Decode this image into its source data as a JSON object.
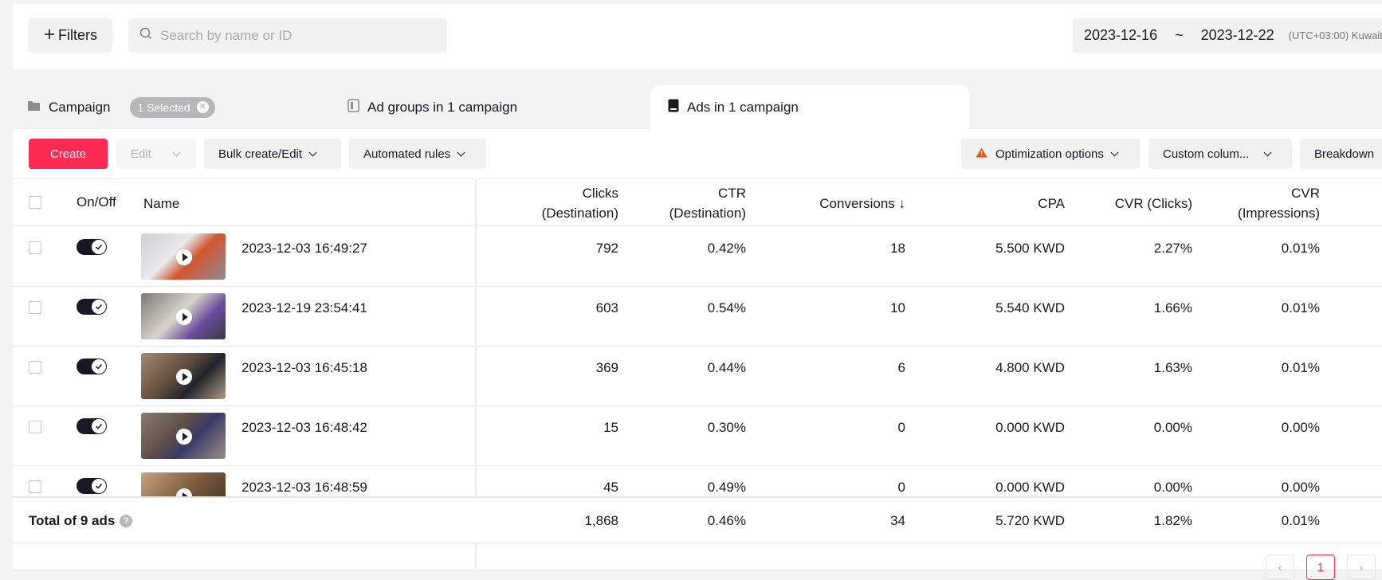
{
  "topbar": {
    "filters_label": "Filters",
    "search_placeholder": "Search by name or ID",
    "date_start": "2023-12-16",
    "date_sep": "~",
    "date_end": "2023-12-22",
    "timezone": "(UTC+03:00) Kuwait"
  },
  "tabs": {
    "campaign_label": "Campaign",
    "selected_pill": "1 Selected",
    "adgroups_label": "Ad groups in 1 campaign",
    "ads_label": "Ads in 1 campaign"
  },
  "toolbar": {
    "create_label": "Create",
    "edit_label": "Edit",
    "bulk_label": "Bulk create/Edit",
    "rules_label": "Automated rules",
    "optimization_label": "Optimization options",
    "custom_columns_label": "Custom colum...",
    "breakdown_label": "Breakdown"
  },
  "table": {
    "headers": {
      "onoff": "On/Off",
      "name": "Name",
      "clicks_l1": "Clicks",
      "clicks_l2": "(Destination)",
      "ctr_l1": "CTR",
      "ctr_l2": "(Destination)",
      "conversions": "Conversions ↓",
      "cpa": "CPA",
      "cvr_clicks": "CVR (Clicks)",
      "cvr_imp_l1": "CVR",
      "cvr_imp_l2": "(Impressions)"
    },
    "rows": [
      {
        "name": "2023-12-03 16:49:27",
        "clicks": "792",
        "ctr": "0.42%",
        "conversions": "18",
        "cpa": "5.500 KWD",
        "cvr_clicks": "2.27%",
        "cvr_imp": "0.01%"
      },
      {
        "name": "2023-12-19 23:54:41",
        "clicks": "603",
        "ctr": "0.54%",
        "conversions": "10",
        "cpa": "5.540 KWD",
        "cvr_clicks": "1.66%",
        "cvr_imp": "0.01%"
      },
      {
        "name": "2023-12-03 16:45:18",
        "clicks": "369",
        "ctr": "0.44%",
        "conversions": "6",
        "cpa": "4.800 KWD",
        "cvr_clicks": "1.63%",
        "cvr_imp": "0.01%"
      },
      {
        "name": "2023-12-03 16:48:42",
        "clicks": "15",
        "ctr": "0.30%",
        "conversions": "0",
        "cpa": "0.000 KWD",
        "cvr_clicks": "0.00%",
        "cvr_imp": "0.00%"
      },
      {
        "name": "2023-12-03 16:48:59",
        "clicks": "45",
        "ctr": "0.49%",
        "conversions": "0",
        "cpa": "0.000 KWD",
        "cvr_clicks": "0.00%",
        "cvr_imp": "0.00%"
      }
    ],
    "total": {
      "label": "Total of 9 ads",
      "clicks": "1,868",
      "ctr": "0.46%",
      "conversions": "34",
      "cpa": "5.720 KWD",
      "cvr_clicks": "1.82%",
      "cvr_imp": "0.01%"
    }
  },
  "pagination": {
    "current_page": "1",
    "prev": "‹",
    "next": "›"
  },
  "colors": {
    "accent": "#fe2c55",
    "warning": "#e8541d"
  }
}
